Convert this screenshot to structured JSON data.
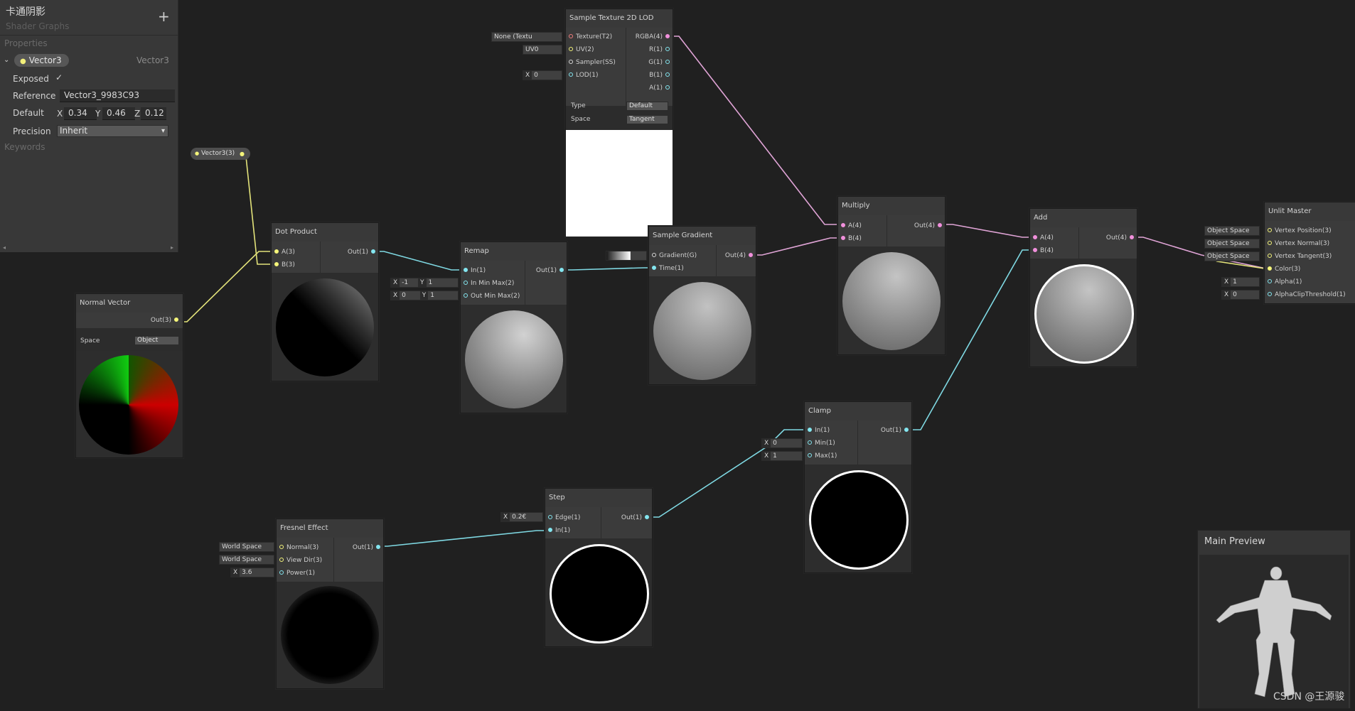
{
  "blackboard": {
    "title": "卡通阴影",
    "subtitle": "Shader Graphs",
    "add_label": "+",
    "properties_label": "Properties",
    "keywords_label": "Keywords",
    "property": {
      "name": "Vector3",
      "type": "Vector3",
      "exposed_label": "Exposed",
      "exposed_check": "✓",
      "reference_label": "Reference",
      "reference_value": "Vector3_9983C93",
      "default_label": "Default",
      "x_label": "X",
      "x": "0.34",
      "y_label": "Y",
      "y": "0.46",
      "z_label": "Z",
      "z": "0.12",
      "precision_label": "Precision",
      "precision_value": "Inherit"
    }
  },
  "vector_prop_node": {
    "label": "Vector3(3)"
  },
  "normal_vector": {
    "title": "Normal Vector",
    "out": "Out(3)",
    "space_label": "Space",
    "space_value": "Object"
  },
  "dot_product": {
    "title": "Dot Product",
    "a": "A(3)",
    "b": "B(3)",
    "out": "Out(1)"
  },
  "remap": {
    "title": "Remap",
    "in": "In(1)",
    "in_min_max": "In Min Max(2)",
    "out_min_max": "Out Min Max(2)",
    "out": "Out(1)",
    "in_x": "-1",
    "in_y": "1",
    "out_x": "0",
    "out_y": "1",
    "x": "X",
    "y": "Y"
  },
  "sample_texture": {
    "title": "Sample Texture 2D LOD",
    "inputs": [
      "Texture(T2)",
      "UV(2)",
      "Sampler(SS)",
      "LOD(1)"
    ],
    "outputs": [
      "RGBA(4)",
      "R(1)",
      "G(1)",
      "B(1)",
      "A(1)"
    ],
    "type_label": "Type",
    "type_value": "Default",
    "space_label": "Space",
    "space_value": "Tangent",
    "texture_stub": "None (Textu",
    "uv_stub": "UV0",
    "lod_stub": "0"
  },
  "sample_gradient": {
    "title": "Sample Gradient",
    "gradient": "Gradient(G)",
    "time": "Time(1)",
    "out": "Out(4)"
  },
  "multiply": {
    "title": "Multiply",
    "a": "A(4)",
    "b": "B(4)",
    "out": "Out(4)"
  },
  "add": {
    "title": "Add",
    "a": "A(4)",
    "b": "B(4)",
    "out": "Out(4)"
  },
  "unlit_master": {
    "title": "Unlit Master",
    "inputs": [
      "Vertex Position(3)",
      "Vertex Normal(3)",
      "Vertex Tangent(3)",
      "Color(3)",
      "Alpha(1)",
      "AlphaClipThreshold(1)"
    ],
    "stubs": [
      "Object Space",
      "Object Space",
      "Object Space"
    ],
    "alpha_value": "1",
    "clip_value": "0"
  },
  "clamp": {
    "title": "Clamp",
    "in": "In(1)",
    "min": "Min(1)",
    "max": "Max(1)",
    "out": "Out(1)",
    "min_value": "0",
    "max_value": "1"
  },
  "step": {
    "title": "Step",
    "edge": "Edge(1)",
    "in": "In(1)",
    "out": "Out(1)",
    "edge_value": "0.2€"
  },
  "fresnel": {
    "title": "Fresnel Effect",
    "normal": "Normal(3)",
    "view_dir": "View Dir(3)",
    "power": "Power(1)",
    "out": "Out(1)",
    "normal_stub": "World Space",
    "view_stub": "World Space",
    "power_value": "3.6"
  },
  "main_preview": {
    "title": "Main Preview"
  },
  "watermark": "CSDN @王源骏",
  "colors": {
    "vector1": "#84e6f0",
    "vector3": "#f5f57a",
    "vector4": "#f190dc",
    "background": "#202020"
  }
}
